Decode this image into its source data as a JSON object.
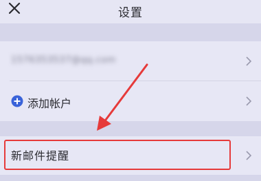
{
  "header": {
    "title": "设置",
    "close_icon": "close-icon"
  },
  "account": {
    "email": "1576353537@qq.com"
  },
  "add_account": {
    "label": "添加帐户",
    "icon": "plus-circle-icon",
    "icon_color": "#3a63d9"
  },
  "notification": {
    "label": "新邮件提醒"
  },
  "annotation": {
    "color": "#e63a3a"
  }
}
